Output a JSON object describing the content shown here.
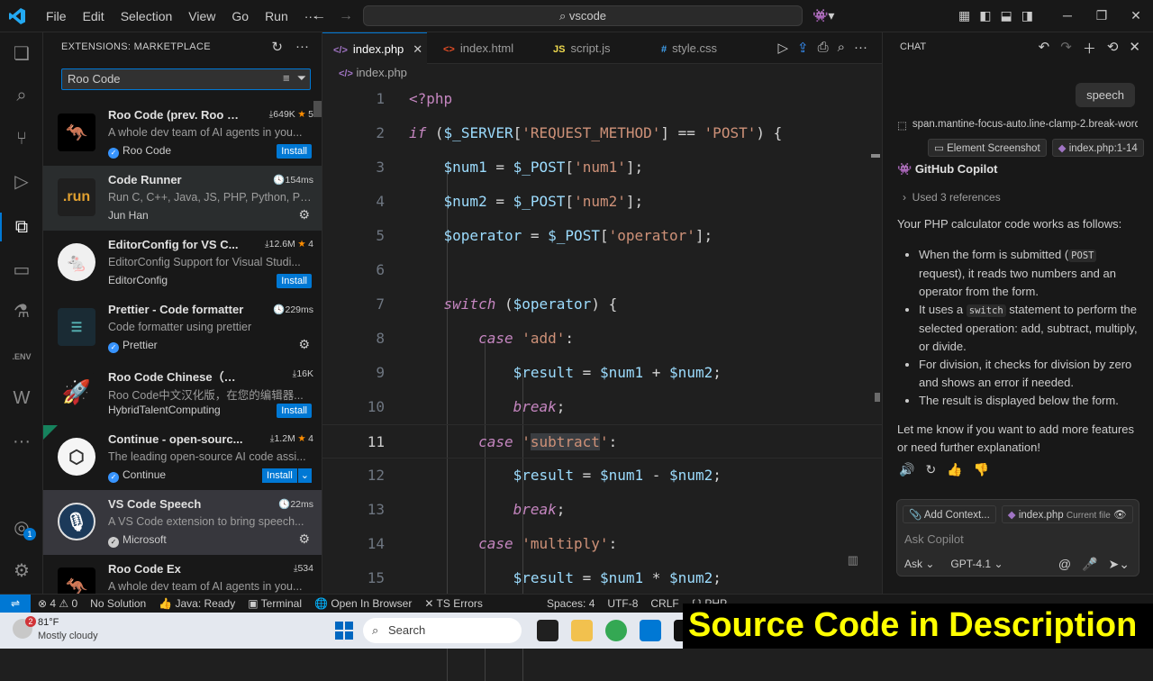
{
  "titlebar": {
    "menu": [
      "File",
      "Edit",
      "Selection",
      "View",
      "Go",
      "Run",
      "···"
    ],
    "command_center": "vscode"
  },
  "sidebar": {
    "title": "EXTENSIONS: MARKETPLACE",
    "search_value": "Roo Code",
    "extensions": [
      {
        "name": "Roo Code (prev. Roo Cl...",
        "stat": "649K",
        "rating": "5",
        "desc": "A whole dev team of AI agents in you...",
        "publisher": "Roo Code",
        "verified": true,
        "action": "Install"
      },
      {
        "name": "Code Runner",
        "stat": "154ms",
        "rating": "",
        "desc": "Run C, C++, Java, JS, PHP, Python, Per...",
        "publisher": "Jun Han",
        "verified": false,
        "action": "gear"
      },
      {
        "name": "EditorConfig for VS C...",
        "stat": "12.6M",
        "rating": "4",
        "desc": "EditorConfig Support for Visual Studi...",
        "publisher": "EditorConfig",
        "verified": false,
        "action": "Install"
      },
      {
        "name": "Prettier - Code formatter",
        "stat": "229ms",
        "rating": "",
        "desc": "Code formatter using prettier",
        "publisher": "Prettier",
        "verified": true,
        "action": "gear"
      },
      {
        "name": "Roo Code Chinese（原Roo ...",
        "stat": "16K",
        "rating": "",
        "desc": "Roo Code中文汉化版，在您的编辑器...",
        "publisher": "HybridTalentComputing",
        "verified": false,
        "action": "Install"
      },
      {
        "name": "Continue - open-sourc...",
        "stat": "1.2M",
        "rating": "4",
        "desc": "The leading open-source AI code assi...",
        "publisher": "Continue",
        "verified": true,
        "action": "Install-split"
      },
      {
        "name": "VS Code Speech",
        "stat": "22ms",
        "rating": "",
        "desc": "A VS Code extension to bring speech...",
        "publisher": "Microsoft",
        "verified": true,
        "action": "gear"
      },
      {
        "name": "Roo Code Ex",
        "stat": "534",
        "rating": "",
        "desc": "A whole dev team of AI agents in you...",
        "publisher": "",
        "verified": false,
        "action": ""
      }
    ]
  },
  "editor": {
    "tabs": [
      {
        "label": "index.php",
        "icon": "php",
        "active": true
      },
      {
        "label": "index.html",
        "icon": "html",
        "active": false
      },
      {
        "label": "script.js",
        "icon": "js",
        "active": false
      },
      {
        "label": "style.css",
        "icon": "css",
        "active": false
      }
    ],
    "breadcrumb": "index.php",
    "current_line": 11,
    "lines": [
      "1",
      "2",
      "3",
      "4",
      "5",
      "6",
      "7",
      "8",
      "9",
      "10",
      "11",
      "12",
      "13",
      "14",
      "15"
    ]
  },
  "chat": {
    "header": "CHAT",
    "user_message": "speech",
    "context_ref": "span.mantine-focus-auto.line-clamp-2.break-word",
    "context_chips": [
      "Element Screenshot",
      "index.php:1-14"
    ],
    "assistant_name": "GitHub Copilot",
    "references": "Used 3 references",
    "intro": "Your PHP calculator code works as follows:",
    "bullets": [
      [
        "When the form is submitted (",
        "POST",
        " request), it reads two numbers and an operator from the form."
      ],
      [
        "It uses a ",
        "switch",
        " statement to perform the selected operation: add, subtract, multiply, or divide."
      ],
      [
        "For division, it checks for division by zero and shows an error if needed.",
        "",
        ""
      ],
      [
        "The result is displayed below the form.",
        "",
        ""
      ]
    ],
    "outro": "Let me know if you want to add more features or need further explanation!",
    "input": {
      "add_context": "Add Context...",
      "file_chip": "index.php",
      "file_note": "Current file",
      "placeholder": "Ask Copilot",
      "mode": "Ask",
      "model": "GPT-4.1"
    }
  },
  "statusbar": {
    "problems": "⊗ 4 ⚠ 0",
    "items": [
      "No Solution",
      "Java: Ready",
      "Terminal",
      "Open In Browser",
      "TS Errors"
    ],
    "right_items": [
      "Spaces: 4",
      "UTF-8",
      "CRLF",
      "{ } PHP"
    ]
  },
  "taskbar": {
    "temp": "81°F",
    "condition": "Mostly cloudy",
    "badge": "2",
    "search": "Search"
  },
  "banner": "Source Code in  Description",
  "colors": {
    "accent": "#0078d4",
    "keyword": "#c586c0",
    "variable": "#9cdcfe",
    "string": "#ce9178",
    "banner_text": "#ffff00"
  }
}
